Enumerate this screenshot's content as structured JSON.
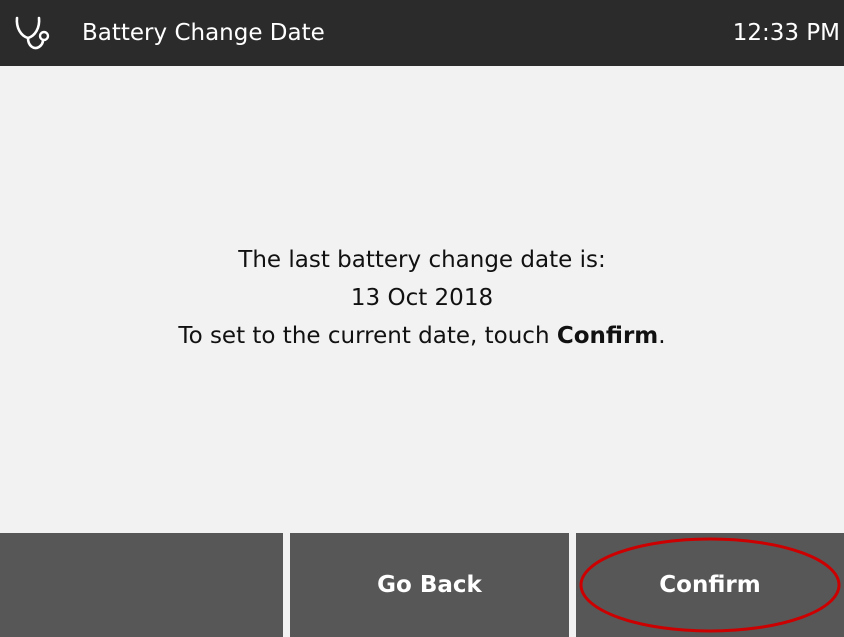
{
  "header": {
    "icon": "stethoscope-icon",
    "title": "Battery Change Date",
    "time": "12:33 PM"
  },
  "message": {
    "line1": "The last battery change date is:",
    "date": "13 Oct 2018",
    "line3_prefix": "To set to the current date, touch ",
    "line3_bold": "Confirm",
    "line3_suffix": "."
  },
  "buttons": {
    "left_label": "",
    "back_label": "Go Back",
    "confirm_label": "Confirm"
  },
  "colors": {
    "header_bg": "#2b2b2b",
    "content_bg": "#f2f2f2",
    "button_bg": "#575757",
    "highlight": "#cc0000"
  }
}
